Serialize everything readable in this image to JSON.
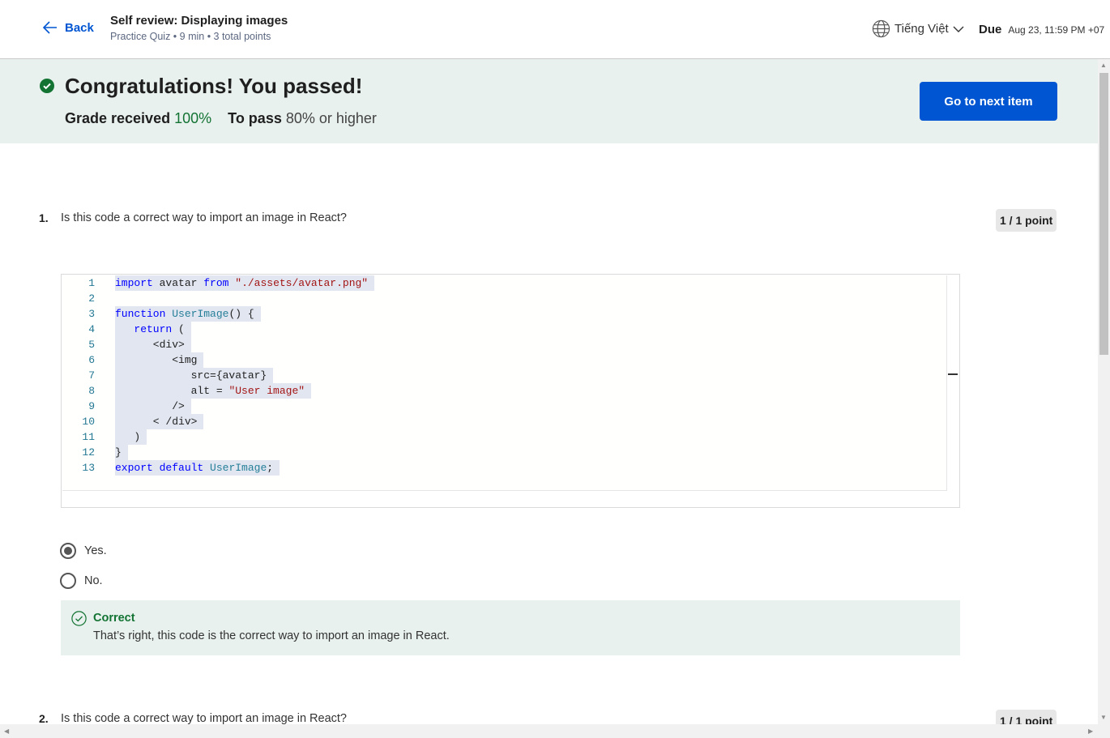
{
  "header": {
    "back_label": "Back",
    "title": "Self review: Displaying images",
    "subtitle": "Practice Quiz • 9 min • 3 total points",
    "language": "Tiếng Việt",
    "due_label": "Due",
    "due_value": "Aug 23, 11:59 PM +07"
  },
  "banner": {
    "heading": "Congratulations! You passed!",
    "grade_label": "Grade received",
    "grade_value": "100%",
    "pass_label": "To pass",
    "pass_value": "80% or higher",
    "next_button": "Go to next item"
  },
  "questions": [
    {
      "number": "1.",
      "text": "Is this code a correct way to import an image in React?",
      "points": "1 / 1 point",
      "code_lines": [
        {
          "n": "1",
          "tokens": [
            {
              "t": "import",
              "c": "kw"
            },
            {
              "t": " avatar ",
              "c": "plain"
            },
            {
              "t": "from",
              "c": "kw"
            },
            {
              "t": " ",
              "c": "plain"
            },
            {
              "t": "\"./assets/avatar.png\"",
              "c": "str"
            }
          ]
        },
        {
          "n": "2",
          "tokens": [
            {
              "t": "",
              "c": "plain"
            }
          ]
        },
        {
          "n": "3",
          "tokens": [
            {
              "t": "function",
              "c": "kw"
            },
            {
              "t": " ",
              "c": "plain"
            },
            {
              "t": "UserImage",
              "c": "fn"
            },
            {
              "t": "() {",
              "c": "plain"
            }
          ]
        },
        {
          "n": "4",
          "tokens": [
            {
              "t": "   ",
              "c": "plain"
            },
            {
              "t": "return",
              "c": "kw"
            },
            {
              "t": " (",
              "c": "plain"
            }
          ]
        },
        {
          "n": "5",
          "tokens": [
            {
              "t": "      <div>",
              "c": "plain"
            }
          ]
        },
        {
          "n": "6",
          "tokens": [
            {
              "t": "         <img",
              "c": "plain"
            }
          ]
        },
        {
          "n": "7",
          "tokens": [
            {
              "t": "            src={avatar}",
              "c": "plain"
            }
          ]
        },
        {
          "n": "8",
          "tokens": [
            {
              "t": "            alt = ",
              "c": "plain"
            },
            {
              "t": "\"User image\"",
              "c": "str"
            }
          ]
        },
        {
          "n": "9",
          "tokens": [
            {
              "t": "         />",
              "c": "plain"
            }
          ]
        },
        {
          "n": "10",
          "tokens": [
            {
              "t": "      < /div>",
              "c": "plain"
            }
          ]
        },
        {
          "n": "11",
          "tokens": [
            {
              "t": "   )",
              "c": "plain"
            }
          ]
        },
        {
          "n": "12",
          "tokens": [
            {
              "t": "}",
              "c": "plain"
            }
          ]
        },
        {
          "n": "13",
          "tokens": [
            {
              "t": "export",
              "c": "kw"
            },
            {
              "t": " ",
              "c": "plain"
            },
            {
              "t": "default",
              "c": "kw"
            },
            {
              "t": " ",
              "c": "plain"
            },
            {
              "t": "UserImage",
              "c": "fn"
            },
            {
              "t": ";",
              "c": "plain"
            }
          ]
        }
      ],
      "options": [
        {
          "label": "Yes.",
          "selected": true
        },
        {
          "label": "No.",
          "selected": false
        }
      ],
      "feedback_title": "Correct",
      "feedback_text": "That’s right, this code is the correct way to import an image in React."
    },
    {
      "number": "2.",
      "text": "Is this code a correct way to import an image in React?",
      "points": "1 / 1 point"
    }
  ],
  "colors": {
    "accent": "#0056d2",
    "success": "#137333",
    "banner_bg": "#e8f1ee"
  }
}
